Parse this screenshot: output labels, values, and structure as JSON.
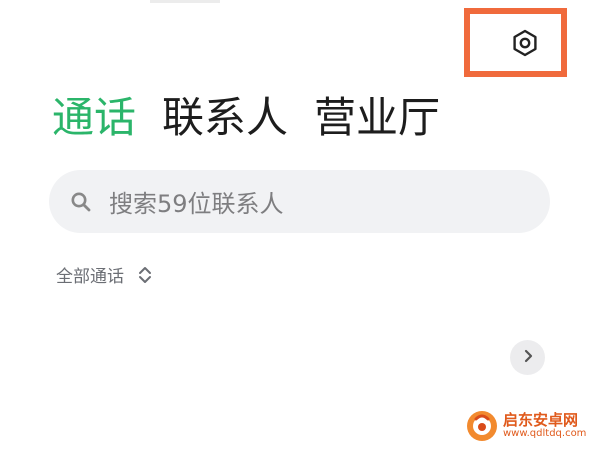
{
  "header": {
    "settings_icon": "gear-icon",
    "highlight_color": "#f06a3c"
  },
  "tabs": [
    {
      "label": "通话",
      "active": true
    },
    {
      "label": "联系人",
      "active": false
    },
    {
      "label": "营业厅",
      "active": false
    }
  ],
  "search": {
    "placeholder": "搜索59位联系人",
    "icon": "search-icon"
  },
  "filter": {
    "label": "全部通话",
    "icon": "sort-toggle-icon"
  },
  "row_action": {
    "icon": "chevron-right-icon"
  },
  "watermark": {
    "title": "启东安卓网",
    "url": "www.qdltdq.com"
  },
  "colors": {
    "accent": "#2bb56a",
    "text": "#1d1d1d",
    "muted": "#7e7e80",
    "search_bg": "#f1f2f4",
    "watermark": "#e05a1c"
  }
}
